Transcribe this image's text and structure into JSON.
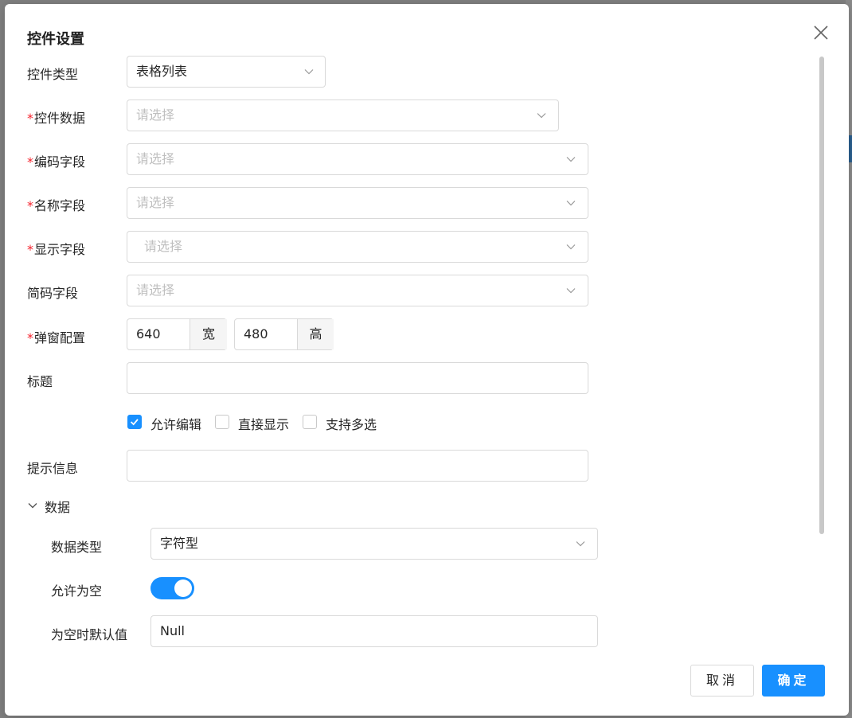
{
  "dialog": {
    "title": "控件设置"
  },
  "form": {
    "control_type": {
      "label": "控件类型",
      "value": "表格列表"
    },
    "control_data": {
      "label": "控件数据",
      "placeholder": "请选择"
    },
    "code_field": {
      "label": "编码字段",
      "placeholder": "请选择"
    },
    "name_field": {
      "label": "名称字段",
      "placeholder": "请选择"
    },
    "display_field": {
      "label": "显示字段",
      "placeholder": "请选择"
    },
    "short_code_field": {
      "label": "简码字段",
      "placeholder": "请选择"
    },
    "popup_config": {
      "label": "弹窗配置",
      "width_value": "640",
      "width_unit": "宽",
      "height_value": "480",
      "height_unit": "高"
    },
    "title_field": {
      "label": "标题",
      "value": ""
    },
    "options": [
      {
        "label": "允许编辑",
        "checked": true
      },
      {
        "label": "直接显示",
        "checked": false
      },
      {
        "label": "支持多选",
        "checked": false
      }
    ],
    "hint_field": {
      "label": "提示信息",
      "value": ""
    },
    "required_mark": "*"
  },
  "data_section": {
    "header": "数据",
    "data_type": {
      "label": "数据类型",
      "value": "字符型"
    },
    "allow_null": {
      "label": "允许为空",
      "on": true
    },
    "null_default": {
      "label": "为空时默认值",
      "value": "Null"
    }
  },
  "footer": {
    "cancel": "取消",
    "ok": "确定"
  },
  "colors": {
    "primary": "#1890ff",
    "required": "#f5222d",
    "border": "#d9d9d9",
    "placeholder": "#bfbfbf"
  }
}
